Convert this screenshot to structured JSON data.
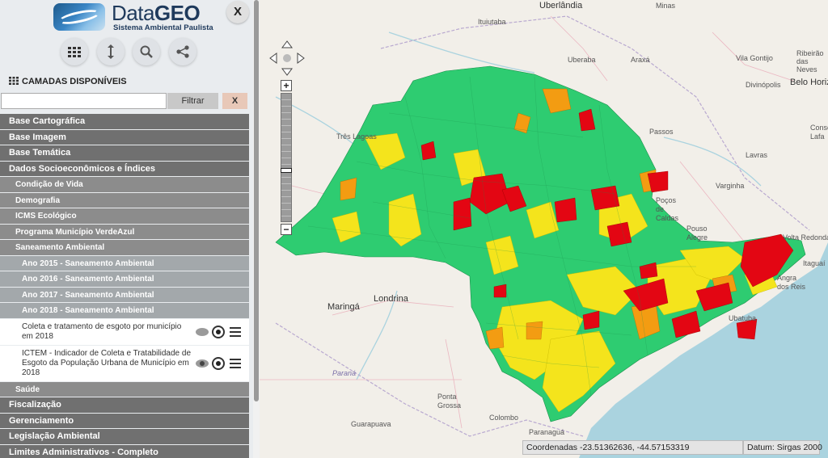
{
  "app": {
    "title_light": "Data",
    "title_bold": "GEO",
    "subtitle": "Sistema Ambiental Paulista",
    "close_label": "X"
  },
  "toolbar": [
    {
      "name": "grid-icon"
    },
    {
      "name": "vertical-arrows-icon"
    },
    {
      "name": "search-icon"
    },
    {
      "name": "share-icon"
    }
  ],
  "layers_panel": {
    "title": "CAMADAS DISPONÍVEIS",
    "filter": {
      "value": "",
      "placeholder": "",
      "button": "Filtrar",
      "clear": "X"
    },
    "items": [
      {
        "label": "Base Cartográfica",
        "level": 1
      },
      {
        "label": "Base Imagem",
        "level": 1
      },
      {
        "label": "Base Temática",
        "level": 1
      },
      {
        "label": "Dados Socioeconômicos e Índices",
        "level": 1
      },
      {
        "label": "Condição de Vida",
        "level": 2
      },
      {
        "label": "Demografia",
        "level": 2
      },
      {
        "label": "ICMS Ecológico",
        "level": 2
      },
      {
        "label": "Programa Município VerdeAzul",
        "level": 2
      },
      {
        "label": "Saneamento Ambiental",
        "level": 2
      },
      {
        "label": "Ano 2015 - Saneamento Ambiental",
        "level": 3
      },
      {
        "label": "Ano 2016 - Saneamento Ambiental",
        "level": 3
      },
      {
        "label": "Ano 2017 - Saneamento Ambiental",
        "level": 3
      },
      {
        "label": "Ano 2018 - Saneamento Ambiental",
        "level": 3
      },
      {
        "label": "Coleta e tratamento de esgoto por município em 2018",
        "level": 4,
        "visible": false
      },
      {
        "label": "ICTEM - Indicador de Coleta e Tratabilidade de Esgoto da População Urbana de Município em 2018",
        "level": 4,
        "visible": true
      },
      {
        "label": "Saúde",
        "level": 2
      },
      {
        "label": "Fiscalização",
        "level": 1
      },
      {
        "label": "Gerenciamento",
        "level": 1
      },
      {
        "label": "Legislação Ambiental",
        "level": 1
      },
      {
        "label": "Limites Administrativos - Completo",
        "level": 1
      }
    ]
  },
  "map": {
    "cities": [
      {
        "name": "Uberlândia",
        "big": true
      },
      {
        "name": "Minas"
      },
      {
        "name": "Ituiutaba"
      },
      {
        "name": "Uberaba"
      },
      {
        "name": "Araxá"
      },
      {
        "name": "Vila Gontijo"
      },
      {
        "name": "Divinópolis"
      },
      {
        "name": "Ribeirão das Neves"
      },
      {
        "name": "Belo Horiz"
      },
      {
        "name": "Três Lagoas"
      },
      {
        "name": "Passos"
      },
      {
        "name": "Lavras"
      },
      {
        "name": "Varginha"
      },
      {
        "name": "Poços de Caldas"
      },
      {
        "name": "Pouso Alegre"
      },
      {
        "name": "Volta Redonda"
      },
      {
        "name": "Itaguaí"
      },
      {
        "name": "Angra dos Reis"
      },
      {
        "name": "Ubatuba"
      },
      {
        "name": "Maringá",
        "big": true
      },
      {
        "name": "Londrina",
        "big": true
      },
      {
        "name": "Paraná",
        "italic": true
      },
      {
        "name": "Ponta Grossa"
      },
      {
        "name": "Colombo"
      },
      {
        "name": "Guarapuava"
      },
      {
        "name": "Paranaguá"
      },
      {
        "name": "Conse Lafa"
      }
    ],
    "legend_colors": {
      "high": "#2ecc71",
      "medium": "#f4e41c",
      "low": "#f39c12",
      "very_low": "#e30613"
    },
    "coordinates_label": "Coordenadas",
    "coordinates": "-23.51362636, -44.57153319",
    "datum_label": "Datum:",
    "datum": "Sirgas 2000"
  }
}
